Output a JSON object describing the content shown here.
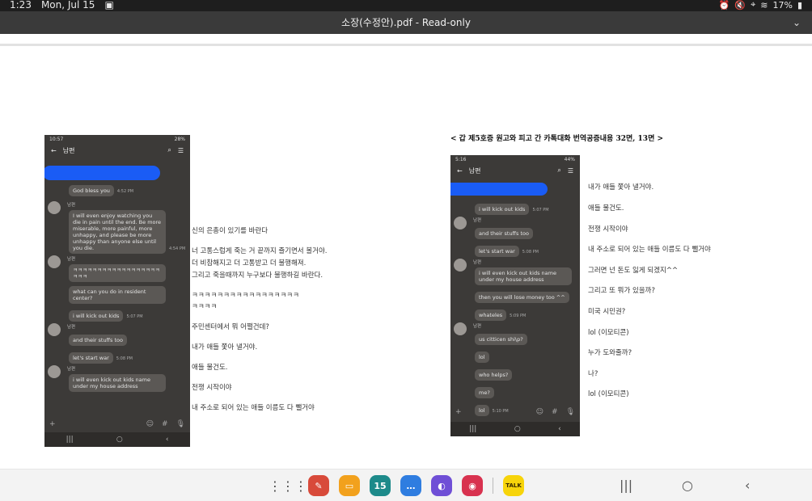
{
  "status": {
    "time": "1:23",
    "date": "Mon, Jul 15",
    "battery": "17%"
  },
  "titlebar": {
    "title": "소장(수정안).pdf - Read-only"
  },
  "caption": "< 갑 제5호증 원고와 피고 간 카톡대화 번역공증내용 32면, 13면 >",
  "phone1": {
    "status_time": "10:57",
    "status_right": "28%",
    "contact": "남편",
    "messages": [
      {
        "text": "God bless you",
        "time": "4:52 PM"
      },
      {
        "name": "남편",
        "text": "I will even enjoy watching you die in pain until the end. Be more miserable, more painful, more unhappy, and please be more unhappy than anyone else until you die.",
        "time": "4:54 PM"
      },
      {
        "name": "남편",
        "text": "ㅋㅋㅋㅋㅋㅋㅋㅋㅋㅋㅋㅋㅋㅋㅋㅋㅋㅋㅋㅋㅋ"
      },
      {
        "text": "what can you do in resident center?"
      },
      {
        "text": "i will kick out kids",
        "time": "5:07 PM"
      },
      {
        "name": "남편",
        "text": "and their stuffs too"
      },
      {
        "text": "let's start war",
        "time": "5:08 PM"
      },
      {
        "name": "남편",
        "text": "i will even kick out kids name under my house address"
      }
    ]
  },
  "phone2": {
    "status_time": "5:16",
    "status_right": "44%",
    "contact": "남편",
    "messages": [
      {
        "text": "i will kick out kids",
        "time": "5:07 PM"
      },
      {
        "name": "남편",
        "text": "and their stuffs too"
      },
      {
        "text": "let's start war",
        "time": "5:08 PM"
      },
      {
        "name": "남편",
        "text": "i will even kick out kids name under my house address"
      },
      {
        "text": "then you will lose money too ^^"
      },
      {
        "text": "whateles",
        "time": "5:09 PM"
      },
      {
        "name": "남편",
        "text": "us citticen shi\\p?"
      },
      {
        "text": "lol"
      },
      {
        "text": "who helps?"
      },
      {
        "text": "me?"
      },
      {
        "text": "lol",
        "time": "5:10 PM"
      }
    ]
  },
  "translation_left": [
    "신의 은총이 있기를 바란다",
    "너 고통스럽게 죽는 거 끝까지 즐기면서 볼거야.",
    "더 비참해지고 더 고통받고 더 불행해져.",
    "그리고 죽을때까지 누구보다 불행하길 바란다.",
    "ㅋㅋㅋㅋㅋㅋㅋㅋㅋㅋㅋㅋㅋㅋㅋㅋㅋ",
    "ㅋㅋㅋㅋ",
    "주민센터에서 뭐 어쩔건데?",
    "내가 애들 쫓아 낼거야.",
    "애들 물건도.",
    "전쟁 시작이야",
    "내 주소로 되어 있는 애들 이름도 다 뺄거야"
  ],
  "translation_right": [
    "내가 애들 쫓아 낼거야.",
    "애들 물건도.",
    "전쟁 시작이야",
    "내 주소로 되어 있는 애들 이름도 다 뺄거야",
    "그러면 넌 돈도 잃게 되겠지^^",
    "그리고 또 뭐가 있을까?",
    "미국 시민권?",
    "lol (이모티콘)",
    "누가 도와줄까?",
    "나?",
    "lol (이모티콘)"
  ],
  "dock": {
    "apps": [
      "app-grid",
      "notes-app",
      "files-app",
      "calendar-app",
      "messages-app",
      "internet-app",
      "gallery-app",
      "kakaotalk-app"
    ],
    "calendar_label": "15",
    "kakao_label": "TALK",
    "colors": {
      "notes": "#d84a3a",
      "files": "#f2a11d",
      "calendar": "#1d8a8a",
      "messages": "#2f7de0",
      "internet": "#6f4fd6",
      "gallery": "#d8324f",
      "kakao": "#f7d40a"
    }
  }
}
